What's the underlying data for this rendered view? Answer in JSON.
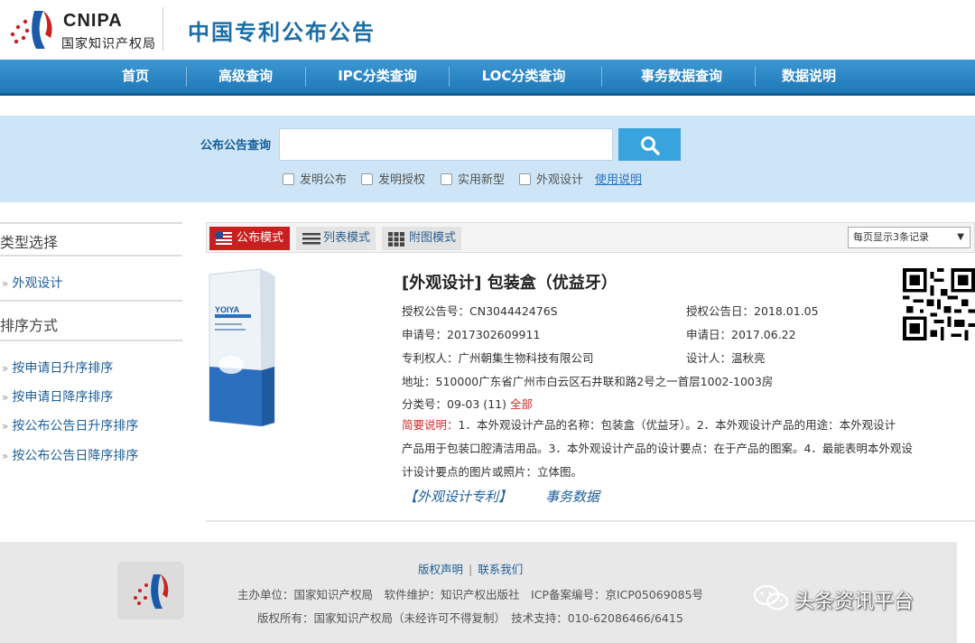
{
  "header": {
    "logo_en": "CNIPA",
    "logo_cn": "国家知识产权局",
    "site_title": "中国专利公布公告"
  },
  "nav": {
    "items": [
      "首页",
      "高级查询",
      "IPC分类查询",
      "LOC分类查询",
      "事务数据查询",
      "数据说明"
    ]
  },
  "search": {
    "label": "公布公告查询",
    "value": "",
    "filters": [
      "发明公布",
      "发明授权",
      "实用新型",
      "外观设计"
    ],
    "help": "使用说明"
  },
  "sidebar": {
    "type_heading": "类型选择",
    "type_items": [
      "外观设计"
    ],
    "sort_heading": "排序方式",
    "sort_items": [
      "按申请日升序排序",
      "按申请日降序排序",
      "按公布公告日升序排序",
      "按公布公告日降序排序"
    ]
  },
  "toolbar": {
    "modes": [
      "公布模式",
      "列表模式",
      "附图模式"
    ],
    "per_page": "每页显示3条记录"
  },
  "record": {
    "title": "[外观设计] 包装盒（优益牙）",
    "grant_no_label": "授权公告号：",
    "grant_no": "CN304442476S",
    "grant_date_label": "授权公告日：",
    "grant_date": "2018.01.05",
    "app_no_label": "申请号：",
    "app_no": "2017302609911",
    "app_date_label": "申请日：",
    "app_date": "2017.06.22",
    "owner_label": "专利权人：",
    "owner": "广州朝集生物科技有限公司",
    "designer_label": "设计人：",
    "designer": "温秋亮",
    "address_label": "地址：",
    "address": "510000广东省广州市白云区石井联和路2号之一首层1002-1003房",
    "class_label": "分类号：",
    "class_no": "09-03 (11)",
    "class_all": "全部",
    "abstract_label": "简要说明：",
    "abstract_line1": "1．本外观设计产品的名称：包装盒（优益牙）。2．本外观设计产品的用途：本外观设计",
    "abstract_line2": "产品用于包装口腔清洁用品。3．本外观设计产品的设计要点：在于产品的图案。4．最能表明本外观设",
    "abstract_line3": "计设计要点的图片或照片：立体图。",
    "link_design": "【外观设计专利】",
    "link_affairs": "事务数据",
    "product_text": "YOIYA"
  },
  "footer": {
    "link_copyright": "版权声明",
    "link_sep": "|",
    "link_contact": "联系我们",
    "line1": "主办单位：国家知识产权局　软件维护：知识产权出版社　ICP备案编号：京ICP05069085号",
    "line2": "版权所有：国家知识产权局（未经许可不得复制）　技术支持：010-62086466/6415"
  },
  "watermark": {
    "text": "头条资讯平台"
  },
  "colors": {
    "nav": "#1f78b8",
    "brand_blue": "#1a6ea8",
    "active_mode": "#c91f1f",
    "search_band": "#cde5f6",
    "search_button": "#38a3dd"
  }
}
